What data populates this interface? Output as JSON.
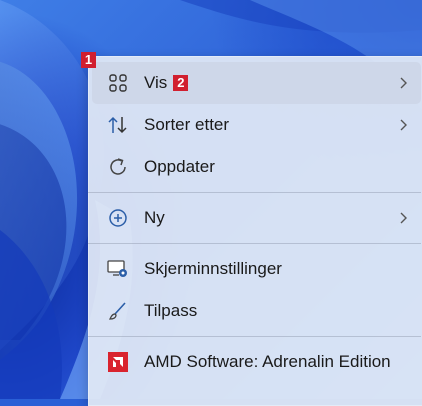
{
  "markers": {
    "one": "1",
    "two": "2"
  },
  "menu": {
    "items": [
      {
        "label": "Vis",
        "icon": "grid-icon",
        "has_submenu": true
      },
      {
        "label": "Sorter etter",
        "icon": "sort-arrows-icon",
        "has_submenu": true
      },
      {
        "label": "Oppdater",
        "icon": "refresh-icon",
        "has_submenu": false
      },
      {
        "label": "Ny",
        "icon": "plus-circle-icon",
        "has_submenu": true
      },
      {
        "label": "Skjerminnstillinger",
        "icon": "display-settings-icon",
        "has_submenu": false
      },
      {
        "label": "Tilpass",
        "icon": "brush-icon",
        "has_submenu": false
      },
      {
        "label": "AMD Software: Adrenalin Edition",
        "icon": "amd-logo-icon",
        "has_submenu": false
      }
    ]
  },
  "colors": {
    "marker_red": "#d11f2f",
    "amd_red": "#d9232e",
    "icon_blue": "#2b5ea8",
    "menu_bg": "#e2e9f5"
  }
}
